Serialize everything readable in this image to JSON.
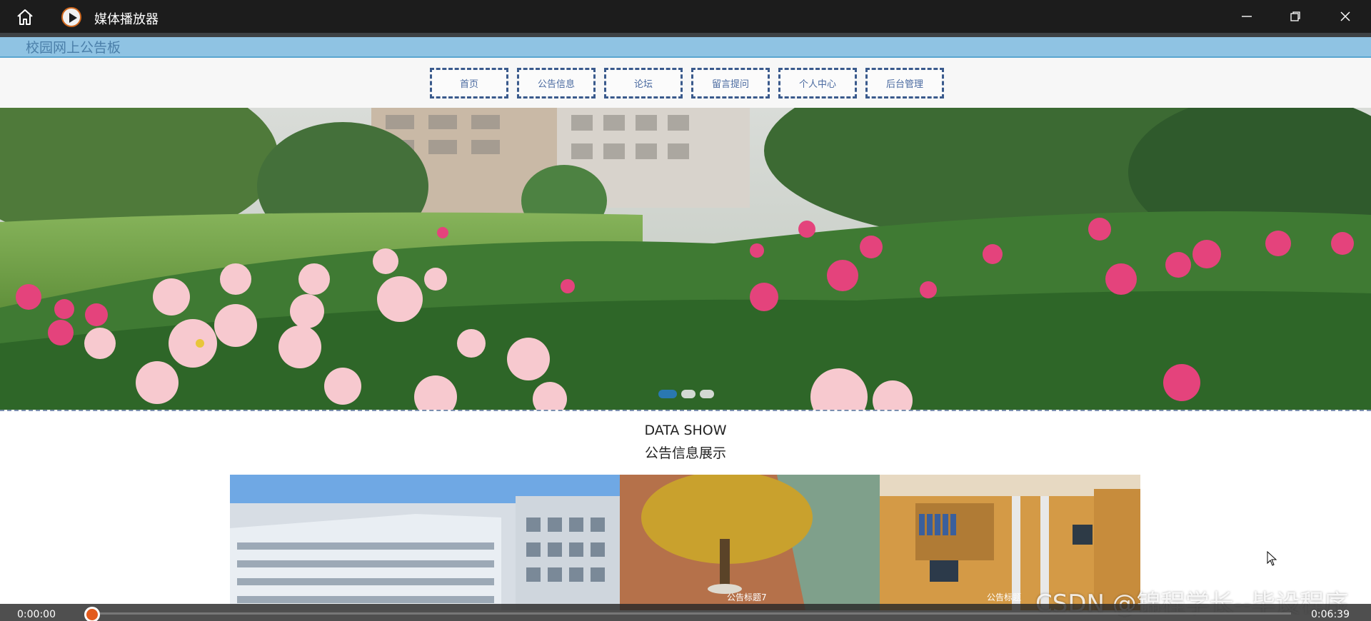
{
  "window": {
    "title": "媒体播放器",
    "icons": {
      "home": "home-icon",
      "app": "play-circle-icon",
      "minimize": "minimize-icon",
      "maximize": "restore-icon",
      "close": "close-icon"
    }
  },
  "site": {
    "brand": "校园网上公告板",
    "nav": [
      "首页",
      "公告信息",
      "论坛",
      "留言提问",
      "个人中心",
      "后台管理"
    ]
  },
  "hero": {
    "slides": 3,
    "active_slide": 1
  },
  "section": {
    "title_en": "DATA SHOW",
    "title_cn": "公告信息展示"
  },
  "gallery": {
    "items": [
      {
        "caption": ""
      },
      {
        "caption": "公告标题7"
      },
      {
        "caption": "公告标题"
      }
    ]
  },
  "player": {
    "current_time": "0:00:00",
    "total_time": "0:06:39",
    "progress": 0.0
  },
  "watermark": "CSDN @锦程学长--毕设程序",
  "colors": {
    "header_blue": "#8fc3e3",
    "nav_border": "#3a5a8c",
    "titlebar": "#1c1c1c",
    "progress_knob": "#e35b1d"
  }
}
